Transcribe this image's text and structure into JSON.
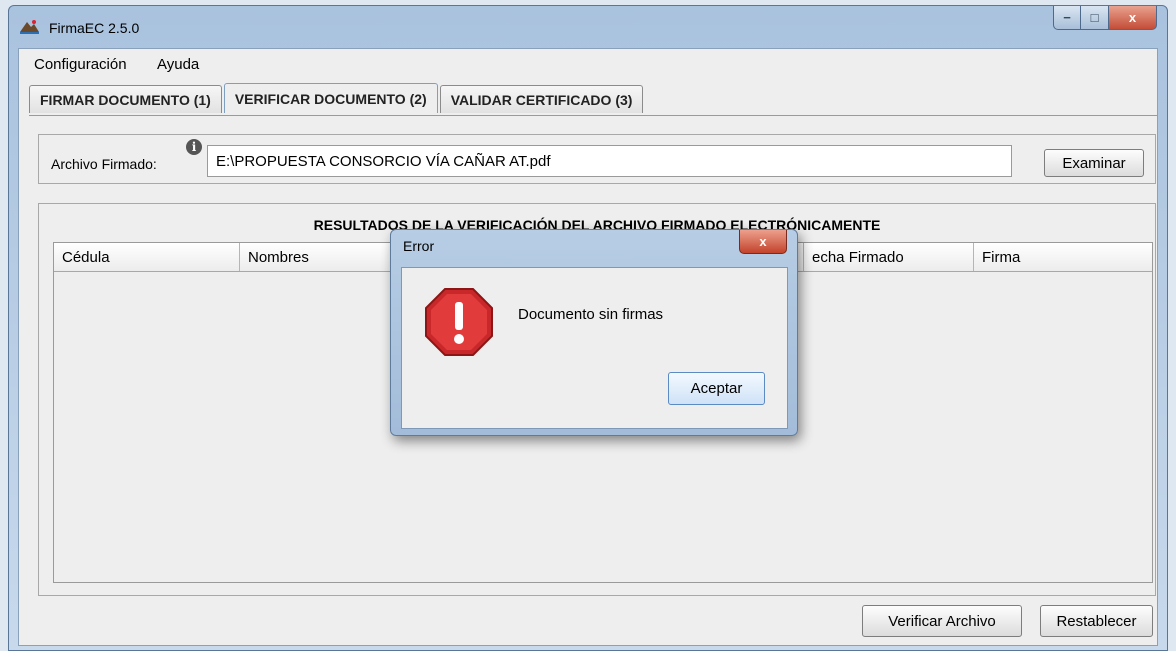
{
  "window": {
    "title": "FirmaEC 2.5.0",
    "min_glyph": "−",
    "max_glyph": "□",
    "close_glyph": "x"
  },
  "menu": {
    "items": [
      "Configuración",
      "Ayuda"
    ]
  },
  "tabs": [
    "FIRMAR DOCUMENTO (1)",
    "VERIFICAR DOCUMENTO (2)",
    "VALIDAR CERTIFICADO (3)"
  ],
  "active_tab": 1,
  "file": {
    "label": "Archivo Firmado:",
    "value": "E:\\PROPUESTA CONSORCIO VÍA CAÑAR AT.pdf",
    "info_glyph": "i"
  },
  "buttons": {
    "examinar": "Examinar",
    "verificar": "Verificar Archivo",
    "restablecer": "Restablecer"
  },
  "results": {
    "title": "RESULTADOS DE LA VERIFICACIÓN DEL ARCHIVO FIRMADO ELECTRÓNICAMENTE",
    "columns": [
      "Cédula",
      "Nombres",
      "echa Firmado",
      "Firma"
    ]
  },
  "dialog": {
    "title": "Error",
    "close_glyph": "x",
    "message": "Documento sin firmas",
    "accept": "Aceptar",
    "icon": "error-stop-icon",
    "icon_color": "#c8282a"
  },
  "colors": {
    "background": "#eeeeee",
    "titlebar": "#b5cbe4",
    "close_button": "#c44d37"
  }
}
